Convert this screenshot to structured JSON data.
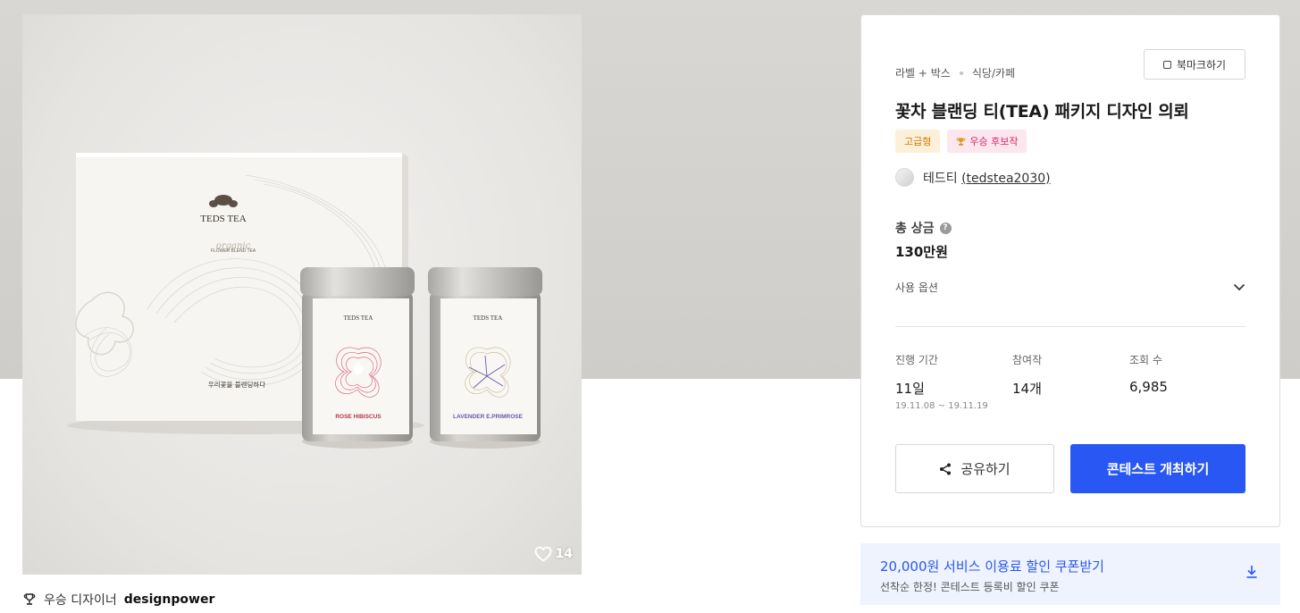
{
  "hero": {
    "likes_count": "14",
    "box_brand": "TEDS TEA",
    "box_subtitle": "FLOWER BLEND TEA",
    "box_script": "organic",
    "box_korean": "우리꽃을 블렌딩하다",
    "tin_left_label": "ROSE HIBISCUS",
    "tin_right_label": "LAVENDER E.PRIMROSE"
  },
  "winner": {
    "prefix": "우승 디자이너",
    "name": "designpower"
  },
  "contest": {
    "category_1": "라벨 + 박스",
    "category_2": "식당/카페",
    "bookmark_label": "북마크하기",
    "title": "꽃차 블랜딩 티(TEA) 패키지 디자인 의뢰",
    "badge_premium": "고급형",
    "badge_candidate": "우승 후보작",
    "owner_name": "테드티",
    "owner_id": "(tedstea2030)",
    "prize_label": "총 상금",
    "prize_value": "130만원",
    "usage_label": "사용 옵션",
    "stats": [
      {
        "label": "진행 기간",
        "value": "11일"
      },
      {
        "label": "참여작",
        "value": "14개"
      },
      {
        "label": "조회 수",
        "value": "6,985"
      }
    ],
    "period": "19.11.08 ~ 19.11.19",
    "share_label": "공유하기",
    "host_label": "콘테스트 개최하기"
  },
  "coupon": {
    "title": "20,000원 서비스 이용료 할인 쿠폰받기",
    "subtitle": "선착순 한정! 콘테스트 등록비 할인 쿠폰"
  },
  "colors": {
    "accent": "#2857f4",
    "premium_badge": "#d07a00",
    "candidate_badge": "#d32a6b"
  }
}
